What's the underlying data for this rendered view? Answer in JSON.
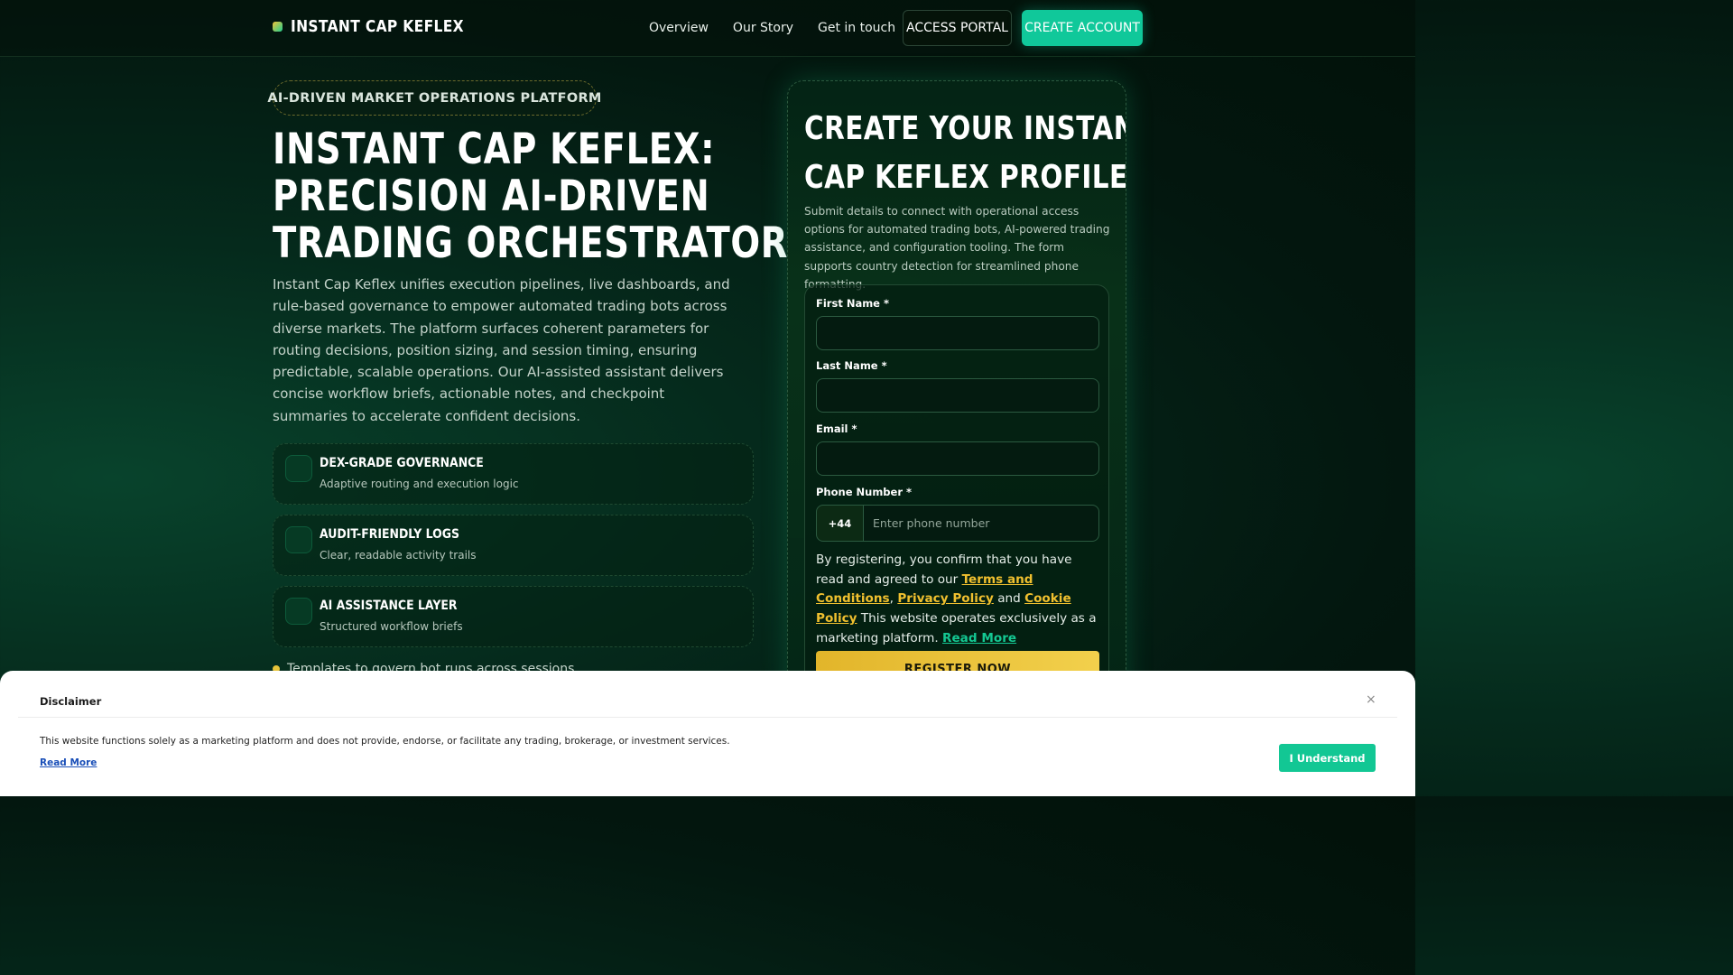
{
  "header": {
    "logo_text": "INSTANT CAP KEFLEX",
    "nav": [
      "Overview",
      "Our Story",
      "Get in touch"
    ],
    "access_portal": "ACCESS PORTAL",
    "create_account": "CREATE ACCOUNT"
  },
  "hero": {
    "tag": "AI-DRIVEN MARKET OPERATIONS PLATFORM",
    "title_lines": [
      "INSTANT CAP KEFLEX:",
      "PRECISION AI-DRIVEN",
      "TRADING ORCHESTRATOR"
    ],
    "description": "Instant Cap Keflex unifies execution pipelines, live dashboards, and rule-based governance to empower automated trading bots across diverse markets. The platform surfaces coherent parameters for routing decisions, position sizing, and session timing, ensuring predictable, scalable operations. Our AI-assisted assistant delivers concise workflow briefs, actionable notes, and checkpoint summaries to accelerate confident decisions.",
    "features": [
      {
        "title": "DEX-GRADE GOVERNANCE",
        "subtitle": "Adaptive routing and execution logic"
      },
      {
        "title": "AUDIT-FRIENDLY LOGS",
        "subtitle": "Clear, readable activity trails"
      },
      {
        "title": "AI ASSISTANCE LAYER",
        "subtitle": "Structured workflow briefs"
      }
    ],
    "bullet": "Templates to govern bot runs across sessions"
  },
  "signup": {
    "title_lines": [
      "CREATE YOUR INSTANT",
      "CAP KEFLEX PROFILE"
    ],
    "description": "Submit details to connect with operational access options for automated trading bots, AI-powered trading assistance, and configuration tooling. The form supports country detection for streamlined phone formatting.",
    "first_name_label": "First Name *",
    "last_name_label": "Last Name *",
    "email_label": "Email *",
    "phone_label": "Phone Number *",
    "phone_prefix": "+44",
    "phone_placeholder": "Enter phone number",
    "consent_prefix": "By registering, you confirm that you have read and agreed to our ",
    "terms": "Terms and Conditions",
    "comma": ", ",
    "privacy": "Privacy Policy",
    "and": " and ",
    "cookie": "Cookie Policy",
    "consent_suffix": " This website operates exclusively as a marketing platform. ",
    "read_more": "Read More",
    "register_button": "REGISTER NOW"
  },
  "disclaimer": {
    "title": "Disclaimer",
    "close": "×",
    "text": "This website functions solely as a marketing platform and does not provide, endorse, or facilitate any trading, brokerage, or investment services.",
    "read_more": "Read More",
    "button": "I Understand"
  }
}
